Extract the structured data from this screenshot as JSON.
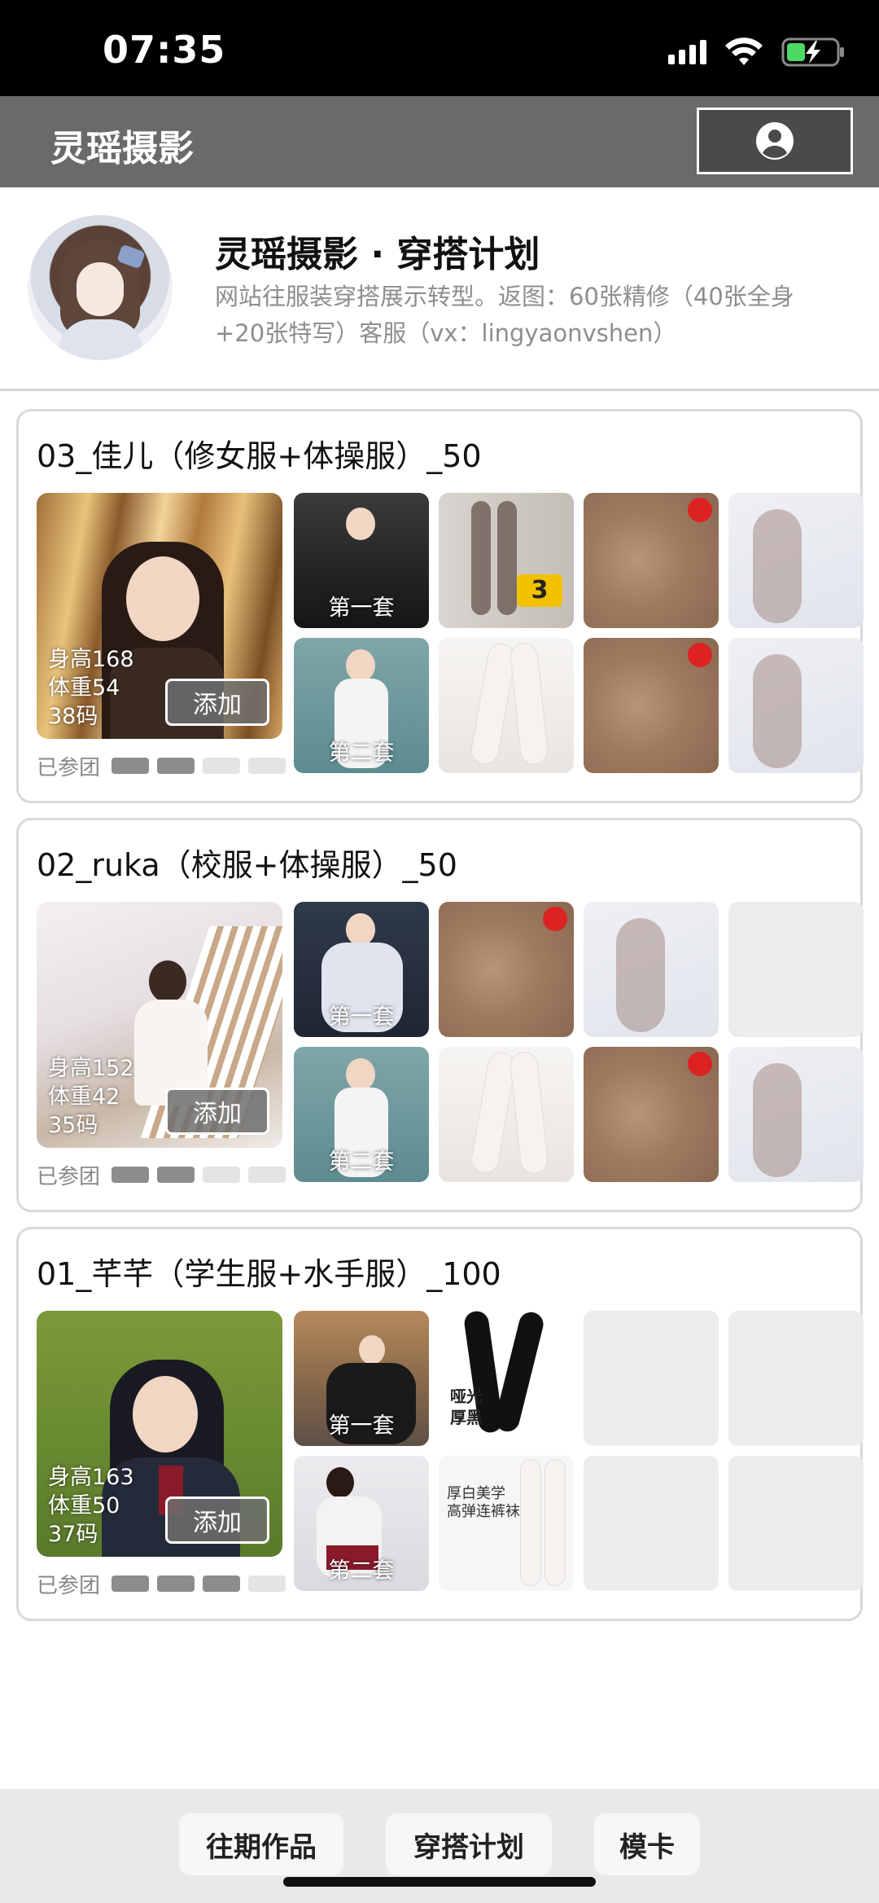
{
  "status_bar": {
    "time": "07:35"
  },
  "header": {
    "title": "灵瑶摄影",
    "user_icon": "user-circle-icon"
  },
  "profile": {
    "title": "灵瑶摄影 · 穿搭计划",
    "description": "网站往服装穿搭展示转型。返图：60张精修（40张全身+20张特写）客服（vx：lingyaonvshen）"
  },
  "cards": [
    {
      "title": "03_佳儿（修女服+体操服）_50",
      "stats": {
        "height": "身高168",
        "weight": "体重54",
        "size": "38码"
      },
      "add_label": "添加",
      "joined_label": "已参团",
      "joined_progress": 2,
      "joined_total": 4,
      "tiles": [
        {
          "caption": "第一套"
        },
        {
          "caption": ""
        },
        {
          "caption": ""
        },
        {
          "caption": ""
        },
        {
          "caption": "第二套"
        },
        {
          "caption": ""
        },
        {
          "caption": ""
        },
        {
          "caption": ""
        }
      ],
      "tile_text": {
        "pack_label": "3"
      }
    },
    {
      "title": "02_ruka（校服+体操服）_50",
      "stats": {
        "height": "身高152",
        "weight": "体重42",
        "size": "35码"
      },
      "add_label": "添加",
      "joined_label": "已参团",
      "joined_progress": 2,
      "joined_total": 4,
      "tiles": [
        {
          "caption": "第一套"
        },
        {
          "caption": ""
        },
        {
          "caption": ""
        },
        {
          "caption": ""
        },
        {
          "caption": "第二套"
        },
        {
          "caption": ""
        },
        {
          "caption": ""
        },
        {
          "caption": ""
        }
      ]
    },
    {
      "title": "01_芊芊（学生服+水手服）_100",
      "stats": {
        "height": "身高163",
        "weight": "体重50",
        "size": "37码"
      },
      "add_label": "添加",
      "joined_label": "已参团",
      "joined_progress": 3,
      "joined_total": 4,
      "tiles": [
        {
          "caption": "第一套"
        },
        {
          "caption": ""
        },
        {
          "caption": ""
        },
        {
          "caption": ""
        },
        {
          "caption": "第二套"
        },
        {
          "caption": ""
        },
        {
          "caption": ""
        },
        {
          "caption": ""
        }
      ],
      "tile_text": {
        "matte_black": "哑光\n厚黑",
        "white_tights": "厚白美学\n高弹连裤袜"
      }
    }
  ],
  "bottom_nav": [
    "往期作品",
    "穿搭计划",
    "模卡"
  ]
}
